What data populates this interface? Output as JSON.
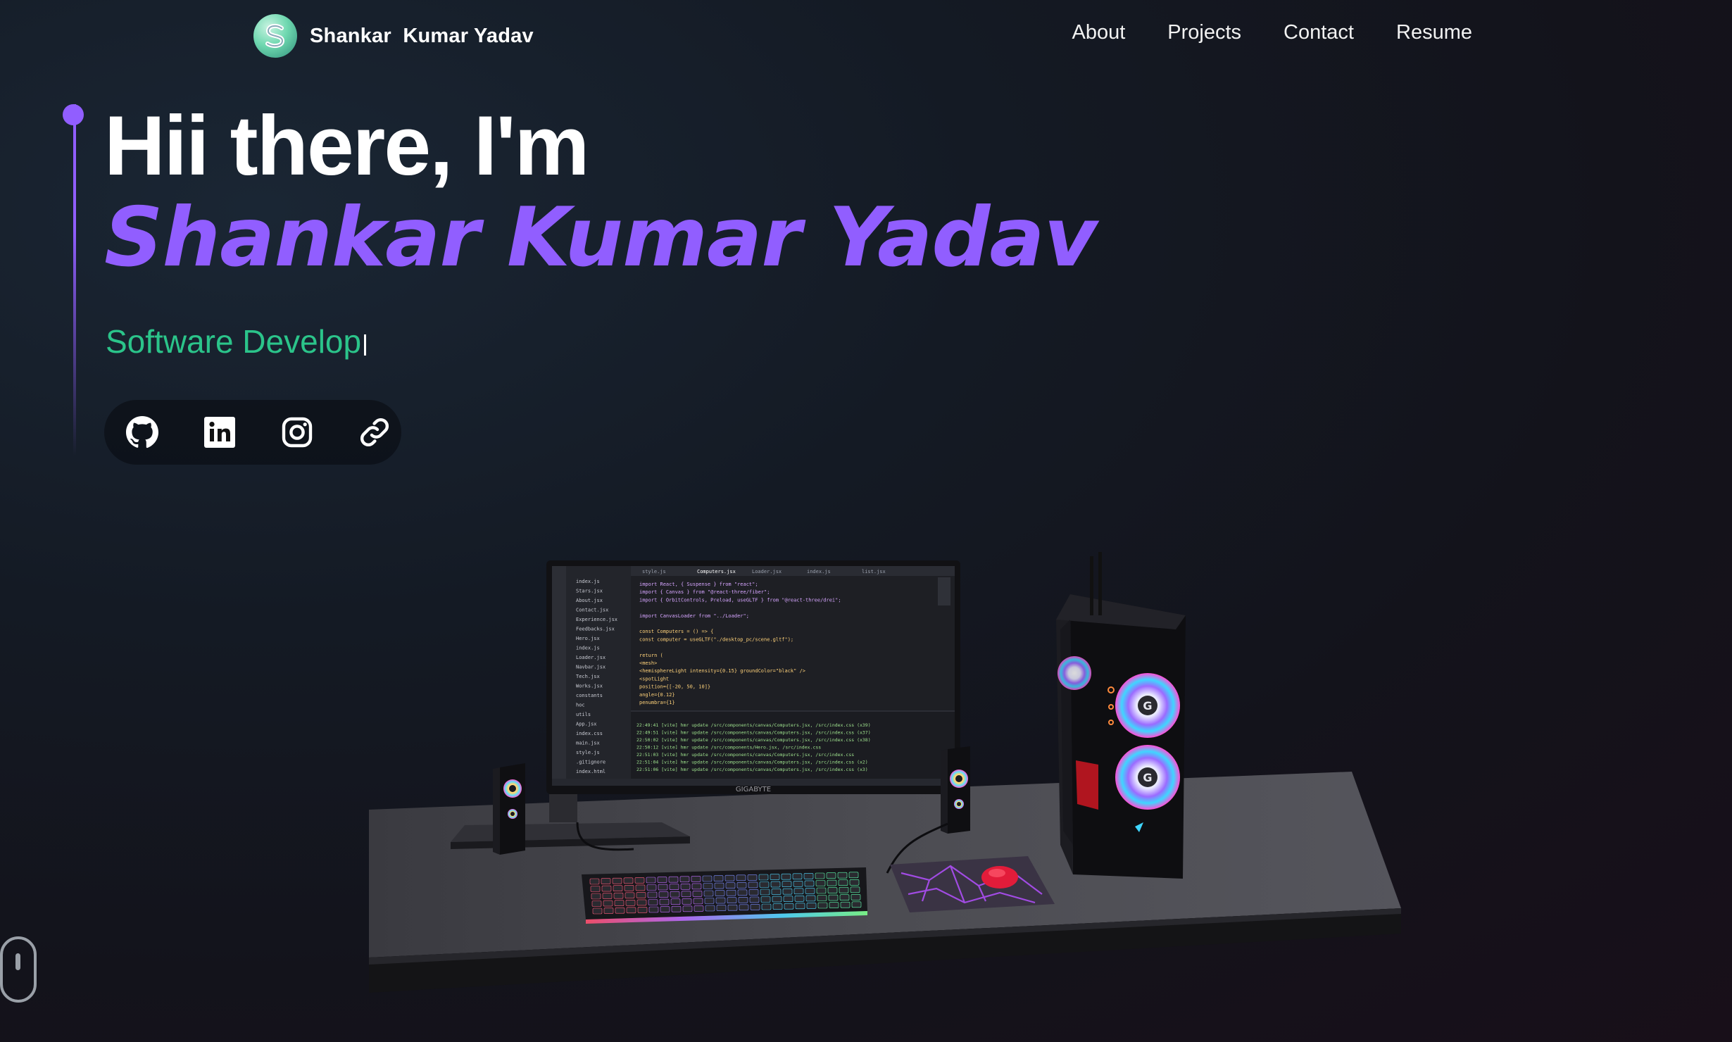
{
  "navbar": {
    "brand": "Shankar  Kumar Yadav",
    "links": [
      "About",
      "Projects",
      "Contact",
      "Resume"
    ]
  },
  "hero": {
    "greeting": "Hii there, I'm",
    "name": "Shankar Kumar Yadav",
    "typed_role": "Software Develop",
    "accent_color": "#915eff",
    "role_color": "#2bc48a"
  },
  "socials": [
    {
      "icon": "github-icon"
    },
    {
      "icon": "linkedin-icon"
    },
    {
      "icon": "instagram-icon"
    },
    {
      "icon": "link-icon"
    }
  ],
  "scene": {
    "monitor_brand": "GIGABYTE",
    "editor_tabs": [
      "style.js",
      "Computers.jsx",
      "Loader.jsx",
      "index.js",
      "list.jsx"
    ],
    "code_lines": [
      "import React, { Suspense } from \"react\";",
      "import { Canvas } from \"@react-three/fiber\";",
      "import { OrbitControls, Preload, useGLTF } from \"@react-three/drei\";",
      "",
      "import CanvasLoader from \"../Loader\";",
      "",
      "const Computers = () => {",
      "  const computer = useGLTF(\"./desktop_pc/scene.gltf\");",
      "",
      "  return (",
      "    <mesh>",
      "      <hemisphereLight intensity={0.15} groundColor=\"black\" />",
      "      <spotLight",
      "        position={[-20, 50, 10]}",
      "        angle={0.12}",
      "        penumbra={1}"
    ],
    "files": [
      "index.js",
      "Stars.jsx",
      "About.jsx",
      "Contact.jsx",
      "Experience.jsx",
      "Feedbacks.jsx",
      "Hero.jsx",
      "index.js",
      "Loader.jsx",
      "Navbar.jsx",
      "Tech.jsx",
      "Works.jsx",
      "constants",
      "hoc",
      "utils",
      "App.jsx",
      "index.css",
      "main.jsx",
      "style.js",
      ".gitignore",
      "index.html"
    ],
    "terminal_lines": [
      "22:49:41 [vite] hmr update /src/components/canvas/Computers.jsx, /src/index.css (x39)",
      "22:49:51 [vite] hmr update /src/components/canvas/Computers.jsx, /src/index.css (x37)",
      "22:50:02 [vite] hmr update /src/components/canvas/Computers.jsx, /src/index.css (x38)",
      "22:50:12 [vite] hmr update /src/components/Hero.jsx, /src/index.css",
      "22:51:03 [vite] hmr update /src/components/canvas/Computers.jsx, /src/index.css",
      "22:51:04 [vite] hmr update /src/components/canvas/Computers.jsx, /src/index.css (x2)",
      "22:51:06 [vite] hmr update /src/components/canvas/Computers.jsx, /src/index.css (x3)"
    ]
  }
}
